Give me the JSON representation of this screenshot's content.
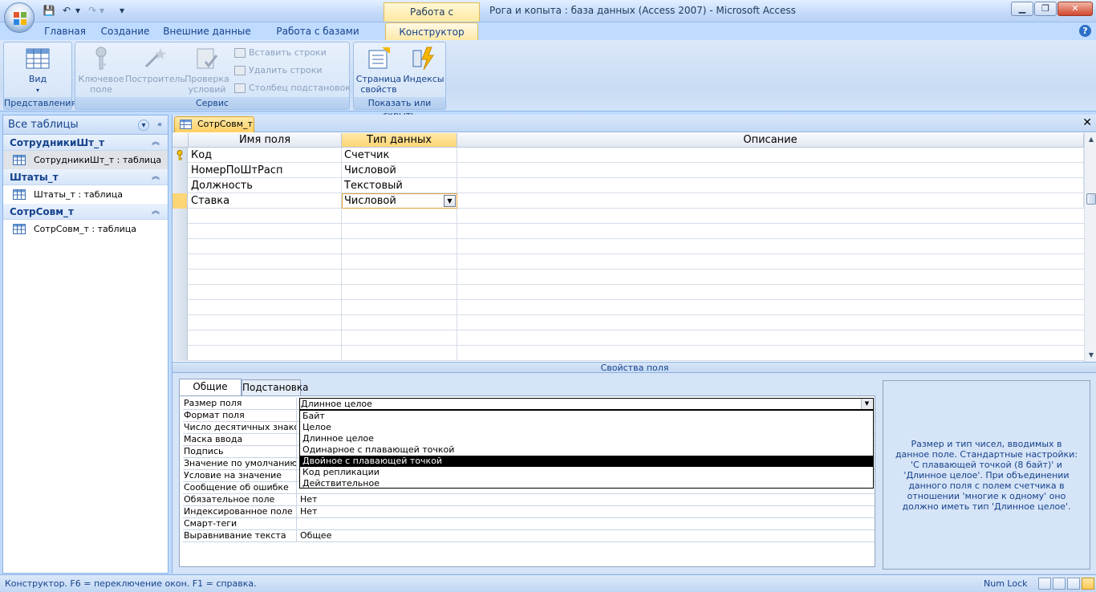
{
  "window": {
    "context_tab": "Работа с таблицами",
    "title": "Рога и копыта : база данных (Access 2007) - Microsoft Access"
  },
  "ribbon_tabs": [
    "Главная",
    "Создание",
    "Внешние данные",
    "Работа с базами данных",
    "Конструктор"
  ],
  "ribbon": {
    "view_label": "Вид",
    "views_group": "Представления",
    "key_field": "Ключевое поле",
    "builder": "Построитель",
    "test_rules": "Проверка условий",
    "insert_rows": "Вставить строки",
    "delete_rows": "Удалить строки",
    "lookup_column": "Столбец подстановок",
    "service_group": "Сервис",
    "property_sheet": "Страница свойств",
    "indexes": "Индексы",
    "showhide_group": "Показать или скрыть"
  },
  "nav": {
    "header": "Все таблицы",
    "groups": [
      {
        "name": "СотрудникиШт_т",
        "item": "СотрудникиШт_т : таблица"
      },
      {
        "name": "Штаты_т",
        "item": "Штаты_т : таблица"
      },
      {
        "name": "СотрСовм_т",
        "item": "СотрСовм_т : таблица"
      }
    ]
  },
  "document": {
    "tab": "СотрСовм_т",
    "headers": {
      "field": "Имя поля",
      "type": "Тип данных",
      "desc": "Описание"
    },
    "rows": [
      {
        "field": "Код",
        "type": "Счетчик"
      },
      {
        "field": "НомерПоШтРасп",
        "type": "Числовой"
      },
      {
        "field": "Должность",
        "type": "Текстовый"
      },
      {
        "field": "Ставка",
        "type": "Числовой"
      }
    ]
  },
  "properties": {
    "title": "Свойства поля",
    "tabs": [
      "Общие",
      "Подстановка"
    ],
    "rows": [
      {
        "name": "Размер поля",
        "value": "Длинное целое"
      },
      {
        "name": "Формат поля",
        "value": ""
      },
      {
        "name": "Число десятичных знаков",
        "value": ""
      },
      {
        "name": "Маска ввода",
        "value": ""
      },
      {
        "name": "Подпись",
        "value": ""
      },
      {
        "name": "Значение по умолчанию",
        "value": ""
      },
      {
        "name": "Условие на значение",
        "value": ""
      },
      {
        "name": "Сообщение об ошибке",
        "value": ""
      },
      {
        "name": "Обязательное поле",
        "value": "Нет"
      },
      {
        "name": "Индексированное поле",
        "value": "Нет"
      },
      {
        "name": "Смарт-теги",
        "value": ""
      },
      {
        "name": "Выравнивание текста",
        "value": "Общее"
      }
    ],
    "dropdown_options": [
      "Байт",
      "Целое",
      "Длинное целое",
      "Одинарное с плавающей точкой",
      "Двойное с плавающей точкой",
      "Код репликации",
      "Действительное"
    ],
    "highlighted_option": "Двойное с плавающей точкой",
    "help_text": "Размер и тип чисел, вводимых в данное поле.  Стандартные настройки: 'С плавающей точкой (8 байт)' и 'Длинное целое'.  При объединении данного поля с полем счетчика в отношении 'многие к одному' оно должно иметь тип 'Длинное целое'."
  },
  "status": {
    "left": "Конструктор.  F6 = переключение окон.  F1 = справка.",
    "numlock": "Num Lock"
  },
  "colors": {
    "accent": "#ffcf62",
    "ribbon": "#c9dcf4",
    "text": "#15428b"
  }
}
